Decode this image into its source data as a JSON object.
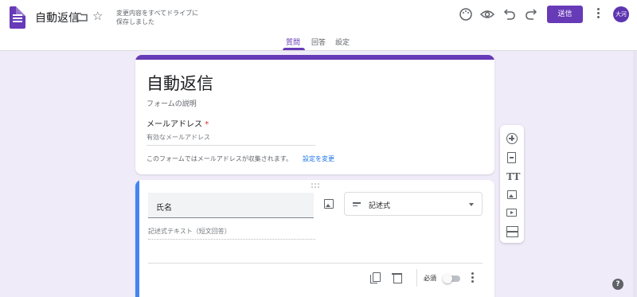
{
  "app": {
    "title": "自動返信",
    "save_status": "変更内容をすべてドライブに保存しました",
    "icons": [
      "forms-logo-icon",
      "folder-icon",
      "star-icon"
    ]
  },
  "header": {
    "icons": [
      "palette-icon",
      "preview-icon",
      "undo-icon",
      "redo-icon"
    ],
    "send_label": "送信",
    "avatar_label": "大河",
    "accent_color": "#673ab7"
  },
  "tabs": [
    {
      "label": "質問",
      "active": true
    },
    {
      "label": "回答",
      "active": false
    },
    {
      "label": "設定",
      "active": false
    }
  ],
  "form": {
    "title": "自動返信",
    "description": "フォームの説明",
    "email_label": "メールアドレス",
    "required_mark": "*",
    "email_placeholder": "有効なメールアドレス",
    "email_note": "このフォームではメールアドレスが収集されます。",
    "email_settings_link": "設定を変更"
  },
  "question": {
    "title": "氏名",
    "type_label": "記述式",
    "answer_placeholder": "記述式テキスト（短文回答）",
    "required_label": "必須",
    "required_on": false,
    "accent_color": "#4285f4"
  },
  "toolbar": {
    "items": [
      "add-question-icon",
      "import-questions-icon",
      "add-title-icon",
      "add-image-icon",
      "add-video-icon",
      "add-section-icon"
    ],
    "title_glyph": "TT"
  },
  "help_label": "?"
}
